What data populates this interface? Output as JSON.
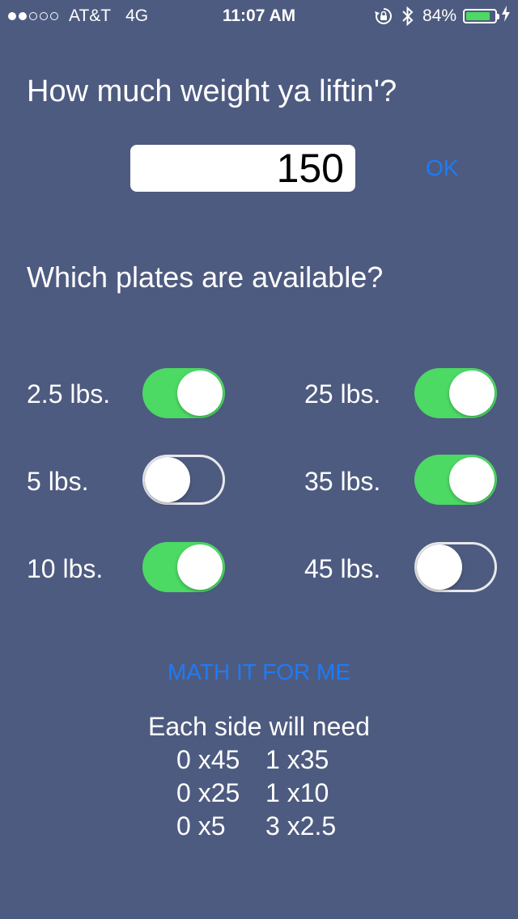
{
  "status_bar": {
    "carrier": "AT&T",
    "network": "4G",
    "time": "11:07 AM",
    "battery": "84%",
    "battery_level": 0.84,
    "signal_bars_filled": 2,
    "signal_bars_total": 5,
    "icons": [
      "rotation-lock-icon",
      "bluetooth-icon",
      "battery-icon",
      "charging-bolt-icon"
    ]
  },
  "weight_section": {
    "question": "How much weight ya liftin'?",
    "value": "150",
    "ok_label": "OK"
  },
  "plates_section": {
    "question": "Which plates are available?",
    "plates": [
      {
        "label": "2.5 lbs.",
        "on": true
      },
      {
        "label": "5 lbs.",
        "on": false
      },
      {
        "label": "10 lbs.",
        "on": true
      },
      {
        "label": "25 lbs.",
        "on": true
      },
      {
        "label": "35 lbs.",
        "on": true
      },
      {
        "label": "45 lbs.",
        "on": false
      }
    ]
  },
  "action": {
    "label": "MATH IT FOR ME"
  },
  "result": {
    "heading": "Each side will need",
    "rows": [
      [
        "0 x45",
        "1 x35"
      ],
      [
        "0 x25",
        "1 x10"
      ],
      [
        "0 x5",
        "3 x2.5"
      ]
    ]
  },
  "colors": {
    "background": "#4e5b80",
    "accent": "#1e7bf5",
    "toggle_on": "#4cd964"
  }
}
